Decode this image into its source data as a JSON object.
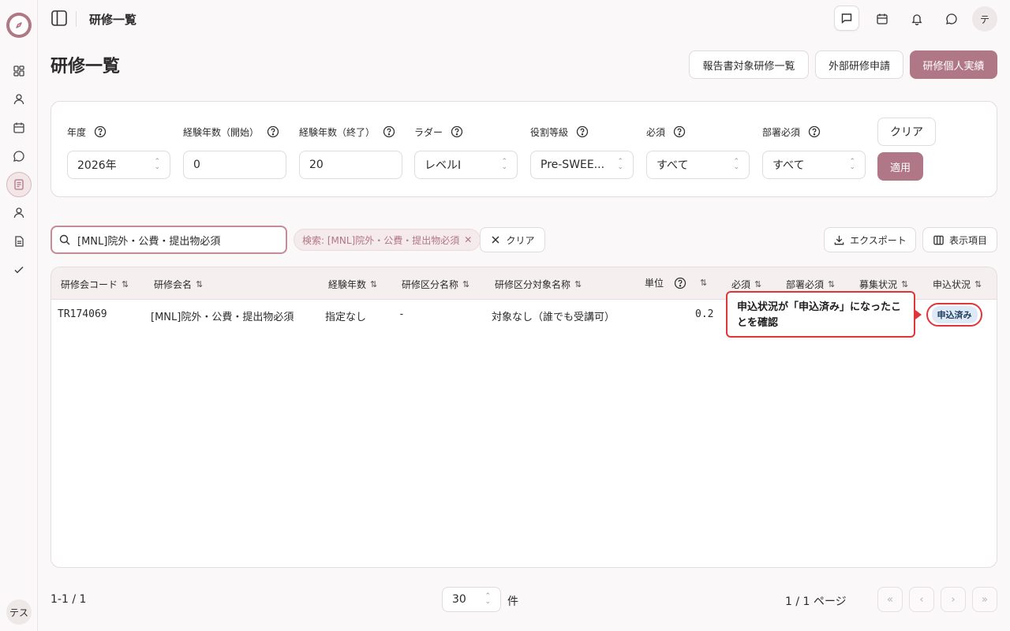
{
  "header": {
    "title": "研修一覧",
    "avatar": "テ"
  },
  "sidebar": {
    "avatar": "テス"
  },
  "page": {
    "title": "研修一覧",
    "actions": [
      "報告書対象研修一覧",
      "外部研修申請",
      "研修個人実績"
    ]
  },
  "filters": {
    "year": {
      "label": "年度",
      "value": "2026年"
    },
    "exp_start": {
      "label": "経験年数（開始）",
      "value": "0"
    },
    "exp_end": {
      "label": "経験年数（終了）",
      "value": "20"
    },
    "ladder": {
      "label": "ラダー",
      "value": "レベルⅠ"
    },
    "role": {
      "label": "役割等級",
      "value": "Pre-SWEE..."
    },
    "required": {
      "label": "必須",
      "value": "すべて"
    },
    "dept_required": {
      "label": "部署必須",
      "value": "すべて"
    },
    "clear_label": "クリア",
    "apply_label": "適用"
  },
  "search": {
    "value": "[MNL]院外・公費・提出物必須",
    "chip": "検索: [MNL]院外・公費・提出物必須",
    "clear_label": "クリア"
  },
  "toolbar": {
    "export_label": "エクスポート",
    "columns_label": "表示項目"
  },
  "table": {
    "headers": [
      "研修会コード",
      "研修会名",
      "経験年数",
      "研修区分名称",
      "研修区分対象名称",
      "単位",
      "必須",
      "部署必須",
      "募集状況",
      "申込状況"
    ],
    "rows": [
      {
        "code": "TR174069",
        "name": "[MNL]院外・公費・提出物必須",
        "experience": "指定なし",
        "category": "-",
        "target": "対象なし（誰でも受講可）",
        "unit": "0.2",
        "status": "申込済み"
      }
    ]
  },
  "annotation": {
    "text": "申込状況が「申込済み」になったことを確認"
  },
  "pagination": {
    "range": "1-1 / 1",
    "per_page": "30",
    "per_page_suffix": "件",
    "page_info": "1 / 1 ページ"
  },
  "colors": {
    "accent": "#b07786",
    "highlight": "#e0363a"
  }
}
